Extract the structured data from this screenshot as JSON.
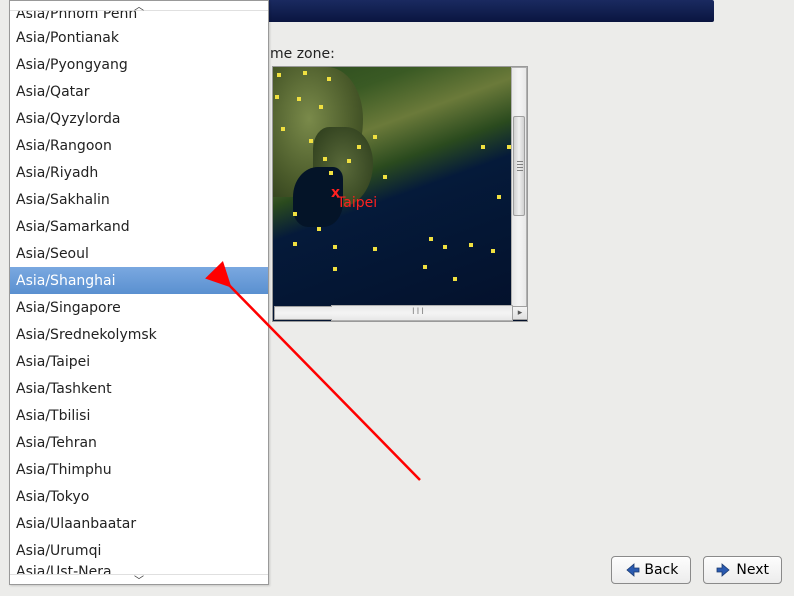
{
  "labels": {
    "timezone_prompt": "me zone:"
  },
  "dropdown": {
    "items": [
      "Asia/Phnom Penh",
      "Asia/Pontianak",
      "Asia/Pyongyang",
      "Asia/Qatar",
      "Asia/Qyzylorda",
      "Asia/Rangoon",
      "Asia/Riyadh",
      "Asia/Sakhalin",
      "Asia/Samarkand",
      "Asia/Seoul",
      "Asia/Shanghai",
      "Asia/Singapore",
      "Asia/Srednekolymsk",
      "Asia/Taipei",
      "Asia/Tashkent",
      "Asia/Tbilisi",
      "Asia/Tehran",
      "Asia/Thimphu",
      "Asia/Tokyo",
      "Asia/Ulaanbaatar",
      "Asia/Urumqi",
      "Asia/Ust-Nera"
    ],
    "selected_index": 10,
    "partial_top_index": 0,
    "partial_bottom_index": 21
  },
  "map": {
    "marker_label": "Taipei",
    "hscroll_thumb": "III"
  },
  "buttons": {
    "back": "Back",
    "next": "Next"
  },
  "colors": {
    "selected_bg_top": "#7aa8e0",
    "selected_bg_bottom": "#5a90d0",
    "annotation_arrow": "#ff0000",
    "marker_text": "#ff2020"
  }
}
